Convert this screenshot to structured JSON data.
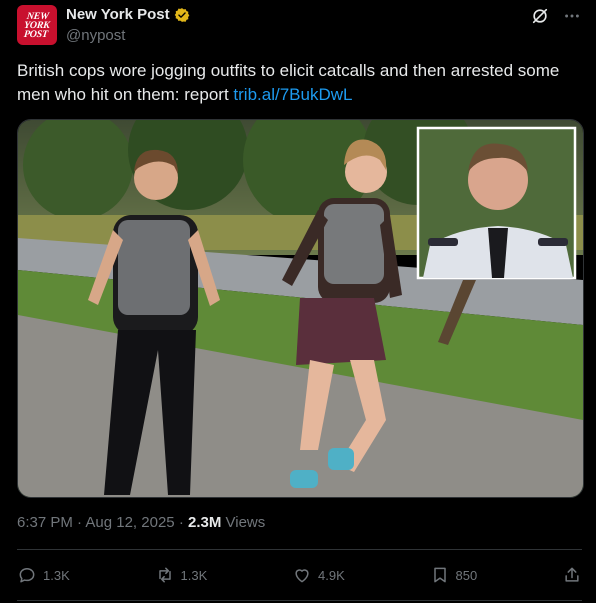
{
  "author": {
    "name": "New York Post",
    "handle": "@nypost",
    "logo_lines": [
      "NEW",
      "YORK",
      "POST"
    ]
  },
  "post": {
    "text": "British cops wore jogging outfits to elicit catcalls and then arrested some men who hit on them: report",
    "link": "trib.al/7BukDwL"
  },
  "meta": {
    "time": "6:37 PM",
    "date": "Aug 12, 2025",
    "views": "2.3M",
    "views_label": "Views"
  },
  "actions": {
    "replies": "1.3K",
    "reposts": "1.3K",
    "likes": "4.9K",
    "bookmarks": "850"
  },
  "colors": {
    "background": "#000000",
    "accent": "#1d9bf0",
    "muted": "#71767b",
    "verified_gold": "#e2b719",
    "brand_red": "#c8102e"
  },
  "icons": [
    "verified-badge-icon",
    "grok-icon",
    "more-icon",
    "reply-icon",
    "repost-icon",
    "like-icon",
    "bookmark-icon",
    "share-icon"
  ]
}
